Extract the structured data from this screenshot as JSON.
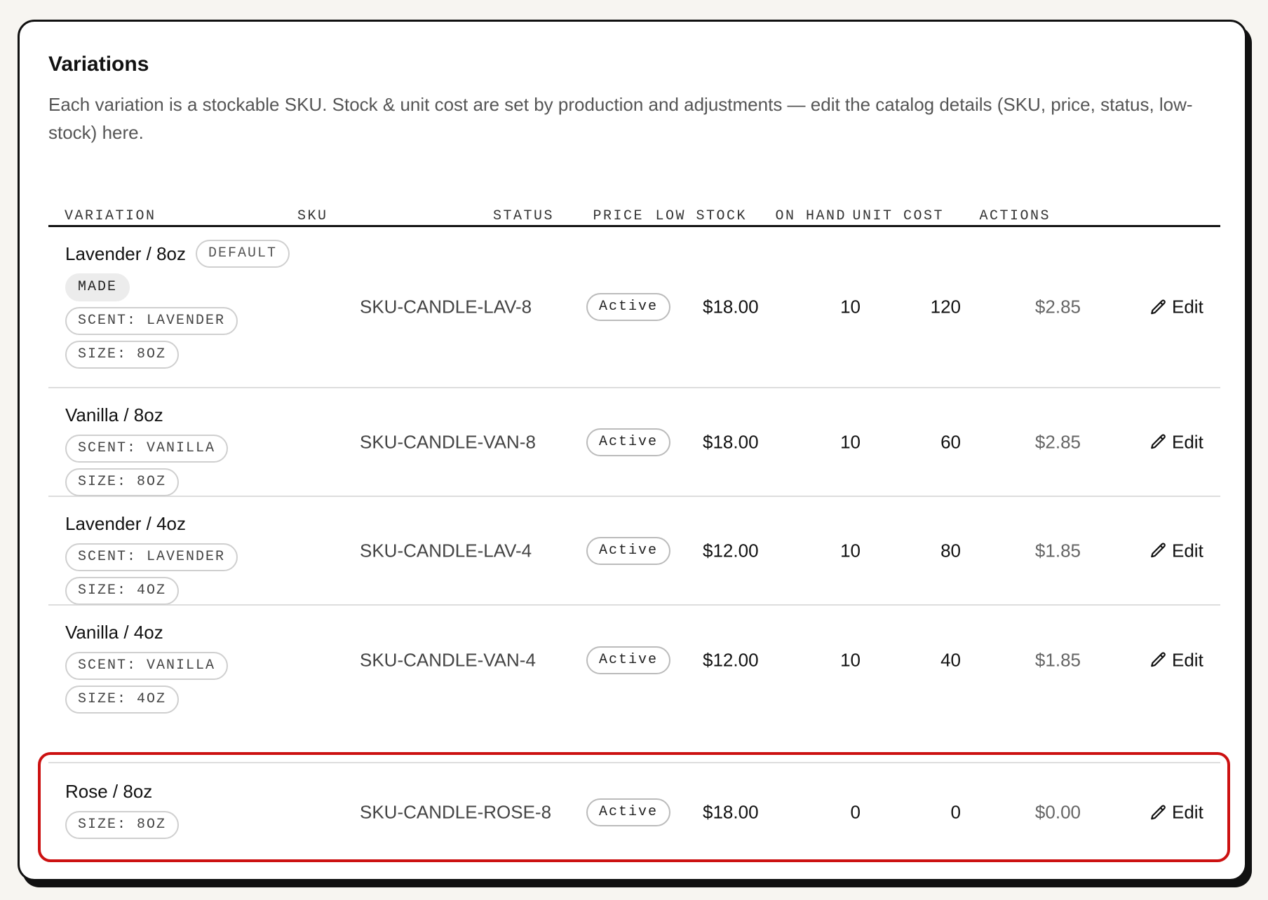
{
  "section": {
    "title": "Variations",
    "description": "Each variation is a stockable SKU. Stock & unit cost are set by production and adjustments — edit the catalog details (SKU, price, status, low-stock) here."
  },
  "columns": {
    "variation": "VARIATION",
    "sku": "SKU",
    "status": "STATUS",
    "price": "PRICE",
    "low_stock": "LOW STOCK",
    "on_hand": "ON HAND",
    "unit_cost": "UNIT COST",
    "actions": "ACTIONS"
  },
  "rows": [
    {
      "name": "Lavender / 8oz",
      "default_badge": "DEFAULT",
      "made_badge": "MADE",
      "tags": [
        "SCENT: LAVENDER",
        "SIZE: 8OZ"
      ],
      "sku": "SKU-CANDLE-LAV-8",
      "status": "Active",
      "price": "$18.00",
      "low_stock": "10",
      "on_hand": "120",
      "unit_cost": "$2.85",
      "action": "Edit"
    },
    {
      "name": "Vanilla / 8oz",
      "tags": [
        "SCENT: VANILLA",
        "SIZE: 8OZ"
      ],
      "sku": "SKU-CANDLE-VAN-8",
      "status": "Active",
      "price": "$18.00",
      "low_stock": "10",
      "on_hand": "60",
      "unit_cost": "$2.85",
      "action": "Edit"
    },
    {
      "name": "Lavender / 4oz",
      "tags": [
        "SCENT: LAVENDER",
        "SIZE: 4OZ"
      ],
      "sku": "SKU-CANDLE-LAV-4",
      "status": "Active",
      "price": "$12.00",
      "low_stock": "10",
      "on_hand": "80",
      "unit_cost": "$1.85",
      "action": "Edit"
    },
    {
      "name": "Vanilla / 4oz",
      "tags": [
        "SCENT: VANILLA",
        "SIZE: 4OZ"
      ],
      "sku": "SKU-CANDLE-VAN-4",
      "status": "Active",
      "price": "$12.00",
      "low_stock": "10",
      "on_hand": "40",
      "unit_cost": "$1.85",
      "action": "Edit"
    },
    {
      "name": "Rose / 8oz",
      "tags": [
        "SIZE: 8OZ"
      ],
      "sku": "SKU-CANDLE-ROSE-8",
      "status": "Active",
      "price": "$18.00",
      "low_stock": "0",
      "on_hand": "0",
      "unit_cost": "$0.00",
      "action": "Edit"
    }
  ],
  "icons": {
    "edit": "pencil-icon"
  },
  "colors": {
    "highlight": "#cc1111",
    "border": "#111111",
    "muted_text": "#555555"
  }
}
